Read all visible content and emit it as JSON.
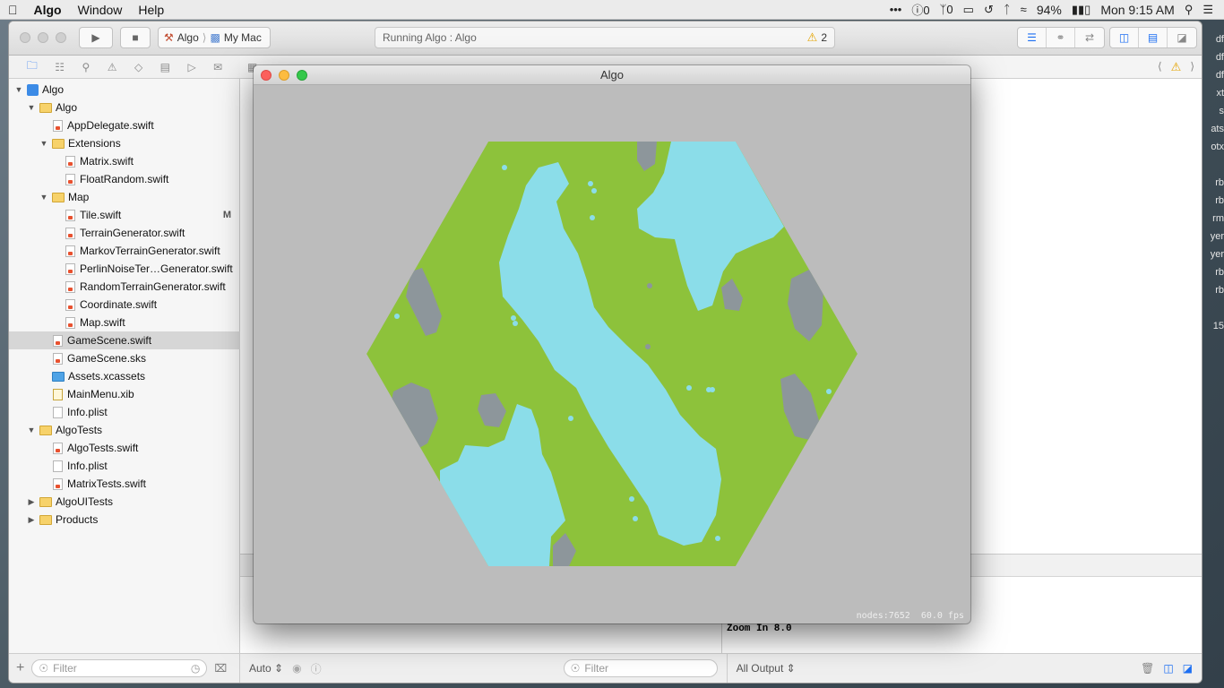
{
  "menubar": {
    "apple_icon": "apple-logo-icon",
    "items": [
      "Algo",
      "Window",
      "Help"
    ],
    "status": {
      "badge_a": "0",
      "badge_b": "0",
      "battery": "94%",
      "clock": "Mon 9:15 AM"
    }
  },
  "desktop_labels": [
    "df",
    "df",
    "df",
    "xt",
    "s",
    "ats",
    "otx",
    "rb",
    "rb",
    "rm",
    "yer",
    "yer",
    "rb",
    "rb",
    "15"
  ],
  "toolbar": {
    "scheme_target": "Algo",
    "scheme_device": "My Mac",
    "activity_text": "Running Algo : Algo",
    "warning_count": "2"
  },
  "navigator": {
    "items": [
      {
        "label": "Algo",
        "icon": "project-icon",
        "disc": "open"
      },
      {
        "label": "Algo",
        "icon": "folder-icon",
        "disc": "open"
      },
      {
        "label": "AppDelegate.swift",
        "icon": "swift-file-icon"
      },
      {
        "label": "Extensions",
        "icon": "folder-icon",
        "disc": "open"
      },
      {
        "label": "Matrix.swift",
        "icon": "swift-file-icon"
      },
      {
        "label": "FloatRandom.swift",
        "icon": "swift-file-icon"
      },
      {
        "label": "Map",
        "icon": "folder-icon",
        "disc": "open"
      },
      {
        "label": "Tile.swift",
        "icon": "swift-file-icon",
        "flag": "M"
      },
      {
        "label": "TerrainGenerator.swift",
        "icon": "swift-file-icon"
      },
      {
        "label": "MarkovTerrainGenerator.swift",
        "icon": "swift-file-icon"
      },
      {
        "label": "PerlinNoiseTer…Generator.swift",
        "icon": "swift-file-icon"
      },
      {
        "label": "RandomTerrainGenerator.swift",
        "icon": "swift-file-icon"
      },
      {
        "label": "Coordinate.swift",
        "icon": "swift-file-icon"
      },
      {
        "label": "Map.swift",
        "icon": "swift-file-icon"
      },
      {
        "label": "GameScene.swift",
        "icon": "swift-file-icon",
        "selected": true
      },
      {
        "label": "GameScene.sks",
        "icon": "sks-file-icon"
      },
      {
        "label": "Assets.xcassets",
        "icon": "asset-catalog-icon"
      },
      {
        "label": "MainMenu.xib",
        "icon": "xib-file-icon"
      },
      {
        "label": "Info.plist",
        "icon": "plist-file-icon"
      },
      {
        "label": "AlgoTests",
        "icon": "folder-icon",
        "disc": "open"
      },
      {
        "label": "AlgoTests.swift",
        "icon": "swift-file-icon"
      },
      {
        "label": "Info.plist",
        "icon": "plist-file-icon"
      },
      {
        "label": "MatrixTests.swift",
        "icon": "swift-file-icon"
      },
      {
        "label": "AlgoUITests",
        "icon": "folder-icon",
        "disc": "closed"
      },
      {
        "label": "Products",
        "icon": "folder-icon",
        "disc": "closed"
      }
    ],
    "filter_placeholder": "Filter"
  },
  "debug": {
    "auto_label": "Auto",
    "filter_placeholder": "Filter",
    "output_label": "All Output",
    "console_lines": [
      "Zoom In 8.0"
    ]
  },
  "game_window": {
    "title": "Algo",
    "nodes_label": "nodes:7652",
    "fps_label": "60.0 fps"
  },
  "colors": {
    "grass": "#8dc23b",
    "water": "#8bdde9",
    "rock": "#8d969b",
    "scene_bg": "#bcbcbc"
  }
}
